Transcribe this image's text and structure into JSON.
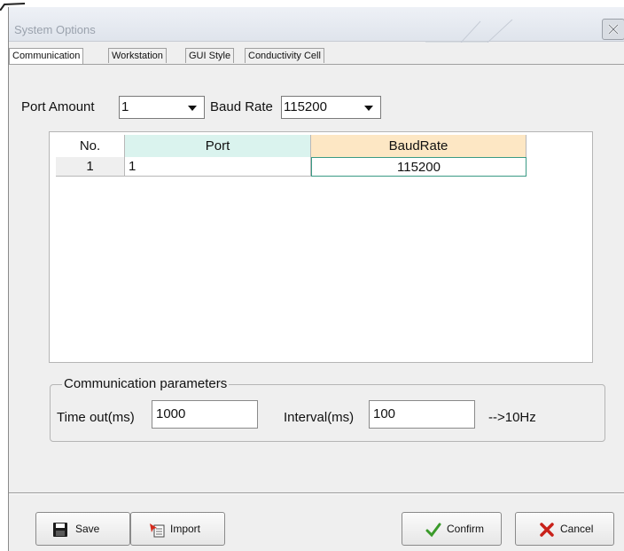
{
  "window": {
    "title": "System Options"
  },
  "tabs": [
    {
      "label": "Communication",
      "active": true
    },
    {
      "label": "Workstation",
      "active": false
    },
    {
      "label": "GUI Style",
      "active": false
    },
    {
      "label": "Conductivity Cell",
      "active": false
    }
  ],
  "settings": {
    "port_amount_label": "Port  Amount",
    "port_amount_value": "1",
    "baud_rate_label": "Baud Rate",
    "baud_rate_value": "115200"
  },
  "grid": {
    "columns": [
      "No.",
      "Port",
      "BaudRate"
    ],
    "header_colors": [
      "#ffffff",
      "#daf3ee",
      "#fde7c4"
    ],
    "rows": [
      {
        "no": "1",
        "port": "1",
        "baudrate": "115200"
      }
    ]
  },
  "comm_params": {
    "group_title": "Communication parameters",
    "timeout_label": "Time out(ms)",
    "timeout_value": "1000",
    "interval_label": "Interval(ms)",
    "interval_value": "100",
    "frequency_text": "-->10Hz"
  },
  "buttons": {
    "save": "Save",
    "import": "Import",
    "confirm": "Confirm",
    "cancel": "Cancel"
  },
  "icons": {
    "save": "floppy-disk-icon",
    "import": "import-arrow-icon",
    "confirm": "green-check-icon",
    "cancel": "red-x-icon",
    "close": "close-icon"
  }
}
